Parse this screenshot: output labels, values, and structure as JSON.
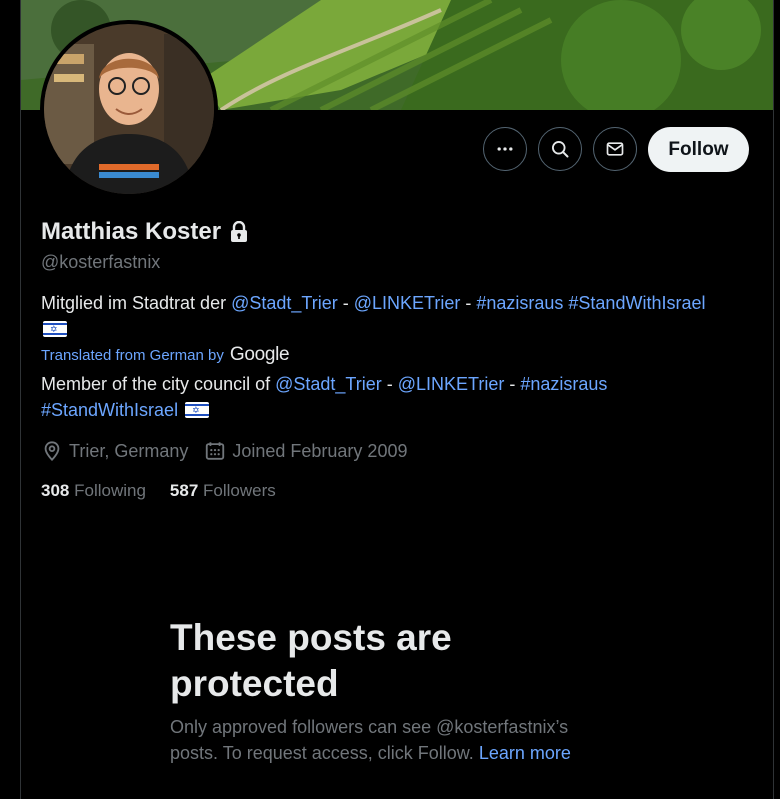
{
  "profile": {
    "display_name": "Matthias Koster",
    "handle": "@kosterfastnix",
    "location": "Trier, Germany",
    "joined": "Joined February 2009"
  },
  "actions": {
    "follow_label": "Follow"
  },
  "icons": {
    "more": "more-horizontal-icon",
    "search": "search-icon",
    "message": "message-envelope-icon",
    "lock": "lock-icon",
    "location": "location-pin-icon",
    "calendar": "calendar-icon",
    "flag": "israel-flag-icon"
  },
  "bio": {
    "prefix": "Mitglied im Stadtrat der ",
    "mention1": "@Stadt_Trier",
    "sep1": " - ",
    "mention2": "@LINKETrier",
    "sep2": " - ",
    "tag1": "#nazisraus",
    "space": " ",
    "tag2": "#StandWithIsrael"
  },
  "translation": {
    "label": "Translated from German by",
    "provider": "Google",
    "prefix": "Member of the city council of ",
    "mention1": "@Stadt_Trier",
    "sep1": " - ",
    "mention2": "@LINKETrier",
    "sep2": " - ",
    "tag1": "#nazisraus",
    "tag2": "#StandWithIsrael"
  },
  "stats": {
    "following_count": "308",
    "following_label": "Following",
    "followers_count": "587",
    "followers_label": "Followers"
  },
  "protected": {
    "title": "These posts are protected",
    "body": "Only approved followers can see @kosterfastnix’s posts. To request access, click Follow.",
    "learn_more": "Learn more"
  },
  "colors": {
    "link": "#6ca6ff",
    "muted": "#71767b",
    "text": "#e7e9ea",
    "background": "#000000",
    "follow_button": "#eff3f4"
  }
}
